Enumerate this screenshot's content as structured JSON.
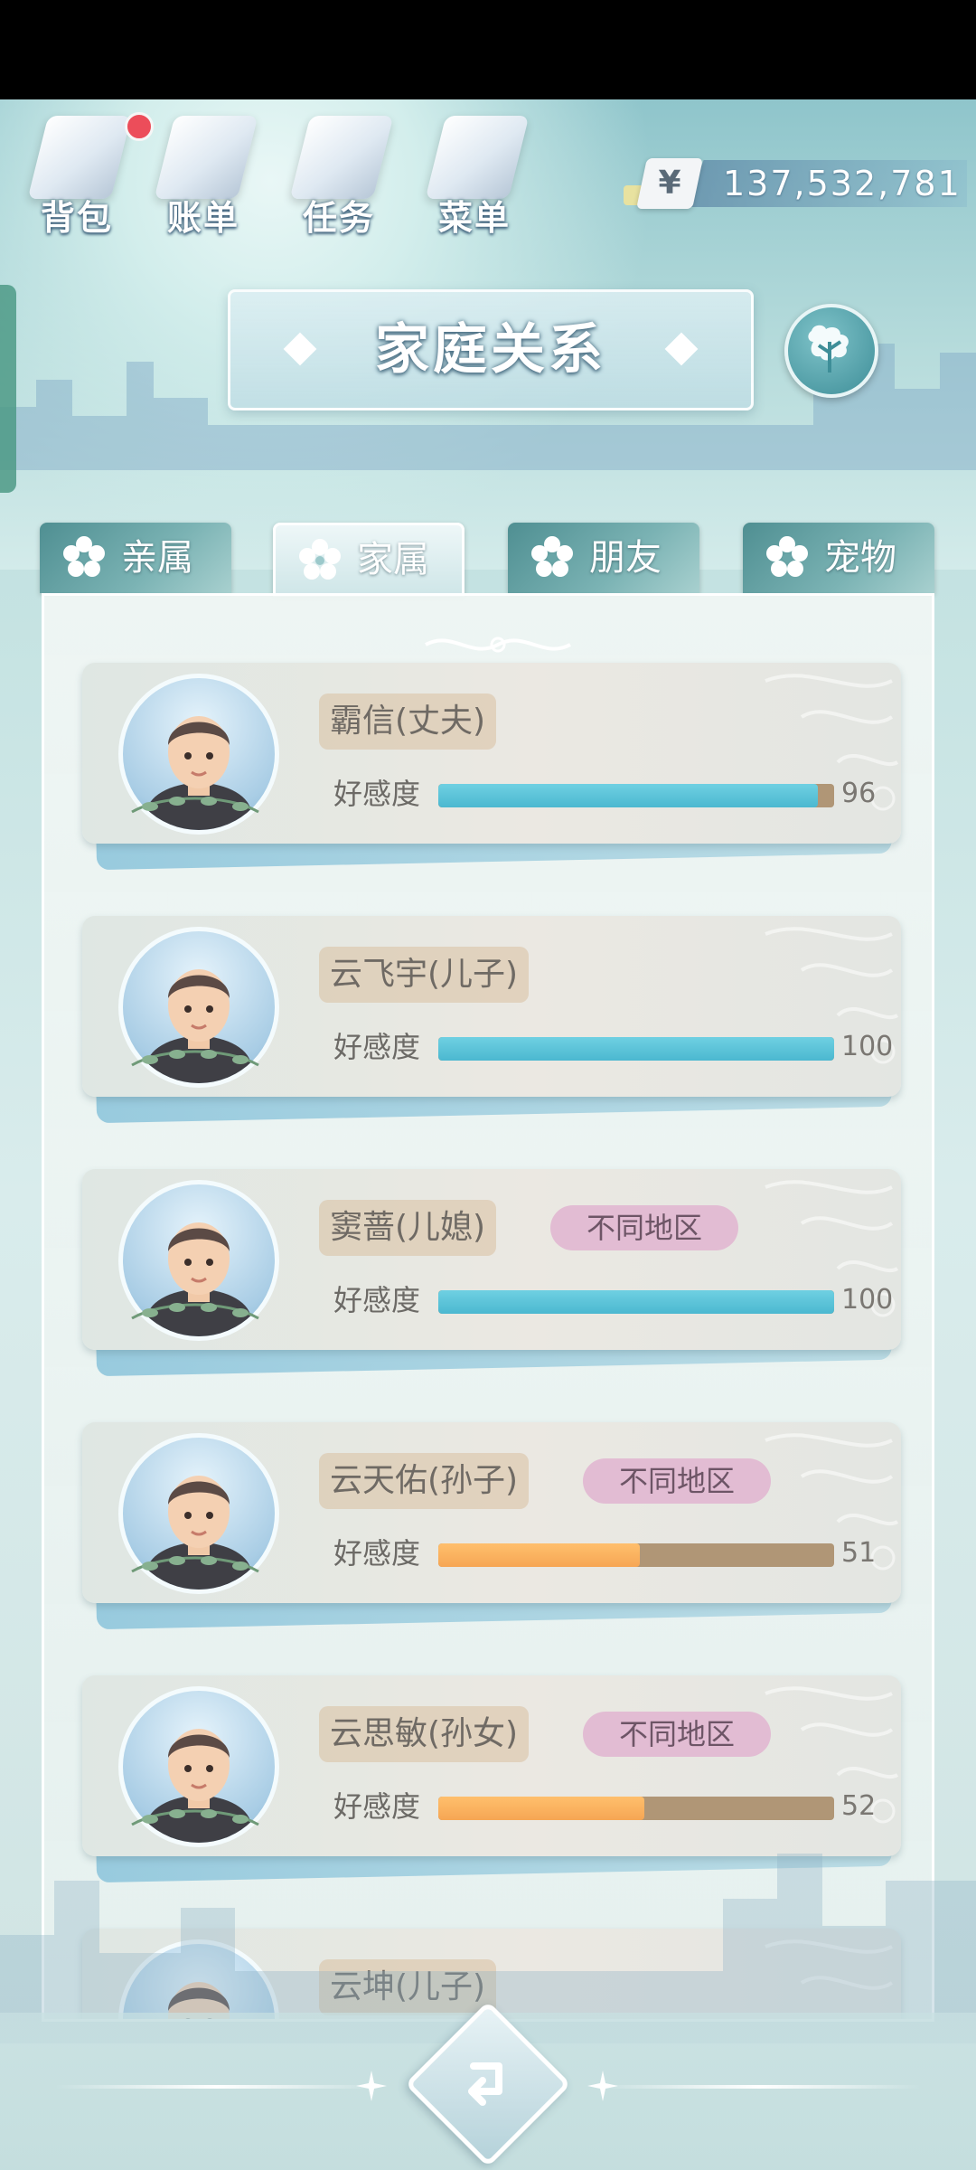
{
  "toolbar": {
    "items": [
      {
        "label": "背包",
        "icon": "backpack-icon",
        "notify": true
      },
      {
        "label": "账单",
        "icon": "bill-icon"
      },
      {
        "label": "任务",
        "icon": "task-icon"
      },
      {
        "label": "菜单",
        "icon": "menu-icon"
      }
    ]
  },
  "money": {
    "symbol": "¥",
    "amount": "137,532,781"
  },
  "title": "家庭关系",
  "tabs": [
    {
      "label": "亲属",
      "active": false
    },
    {
      "label": "家属",
      "active": true
    },
    {
      "label": "朋友",
      "active": false
    },
    {
      "label": "宠物",
      "active": false
    }
  ],
  "affinity_label": "好感度",
  "members": [
    {
      "name": "霸信(丈夫)",
      "tag": "",
      "affinity": 96,
      "color": "blue"
    },
    {
      "name": "云飞宇(儿子)",
      "tag": "",
      "affinity": 100,
      "color": "blue"
    },
    {
      "name": "窦蔷(儿媳)",
      "tag": "不同地区",
      "affinity": 100,
      "color": "blue"
    },
    {
      "name": "云天佑(孙子)",
      "tag": "不同地区",
      "affinity": 51,
      "color": "orange"
    },
    {
      "name": "云思敏(孙女)",
      "tag": "不同地区",
      "affinity": 52,
      "color": "orange"
    },
    {
      "name": "云坤(儿子)",
      "tag": "",
      "affinity": null,
      "color": "blue"
    }
  ],
  "colors": {
    "bar_blue": "#4bb8d0",
    "bar_orange": "#f6a654",
    "bar_track": "#b09676",
    "tag_pink": "#e2bcd3"
  }
}
